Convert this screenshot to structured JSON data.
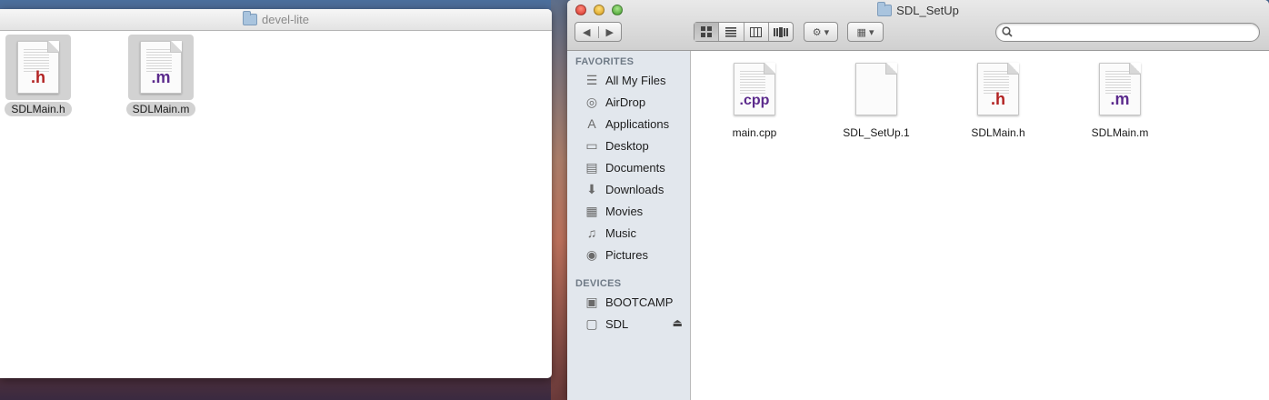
{
  "left_window": {
    "title": "devel-lite",
    "files": [
      {
        "name": "SDLMain.h",
        "ext": ".h",
        "selected": true
      },
      {
        "name": "SDLMain.m",
        "ext": ".m",
        "selected": true
      }
    ]
  },
  "right_window": {
    "title": "SDL_SetUp",
    "toolbar": {
      "back_glyph": "◀",
      "forward_glyph": "▶",
      "view_icons": [
        "view-icons-icon",
        "view-list-icon",
        "view-columns-icon",
        "view-coverflow-icon"
      ],
      "active_view": 0,
      "action_glyph": "⚙ ▾",
      "arrange_glyph": "▦ ▾",
      "search_placeholder": ""
    },
    "sidebar": {
      "favorites_header": "FAVORITES",
      "favorites": [
        {
          "label": "All My Files",
          "icon": "all-files-icon",
          "glyph": "☰"
        },
        {
          "label": "AirDrop",
          "icon": "airdrop-icon",
          "glyph": "◎"
        },
        {
          "label": "Applications",
          "icon": "applications-icon",
          "glyph": "A"
        },
        {
          "label": "Desktop",
          "icon": "desktop-icon",
          "glyph": "▭"
        },
        {
          "label": "Documents",
          "icon": "documents-icon",
          "glyph": "▤"
        },
        {
          "label": "Downloads",
          "icon": "downloads-icon",
          "glyph": "⬇"
        },
        {
          "label": "Movies",
          "icon": "movies-icon",
          "glyph": "▦"
        },
        {
          "label": "Music",
          "icon": "music-icon",
          "glyph": "♫"
        },
        {
          "label": "Pictures",
          "icon": "pictures-icon",
          "glyph": "◉"
        }
      ],
      "devices_header": "DEVICES",
      "devices": [
        {
          "label": "BOOTCAMP",
          "icon": "hard-drive-icon",
          "glyph": "▣",
          "eject": false
        },
        {
          "label": "SDL",
          "icon": "disk-image-icon",
          "glyph": "▢",
          "eject": true
        }
      ],
      "eject_glyph": "⏏"
    },
    "files": [
      {
        "name": "main.cpp",
        "ext": ".cpp"
      },
      {
        "name": "SDL_SetUp.1",
        "ext": ""
      },
      {
        "name": "SDLMain.h",
        "ext": ".h"
      },
      {
        "name": "SDLMain.m",
        "ext": ".m"
      }
    ]
  }
}
